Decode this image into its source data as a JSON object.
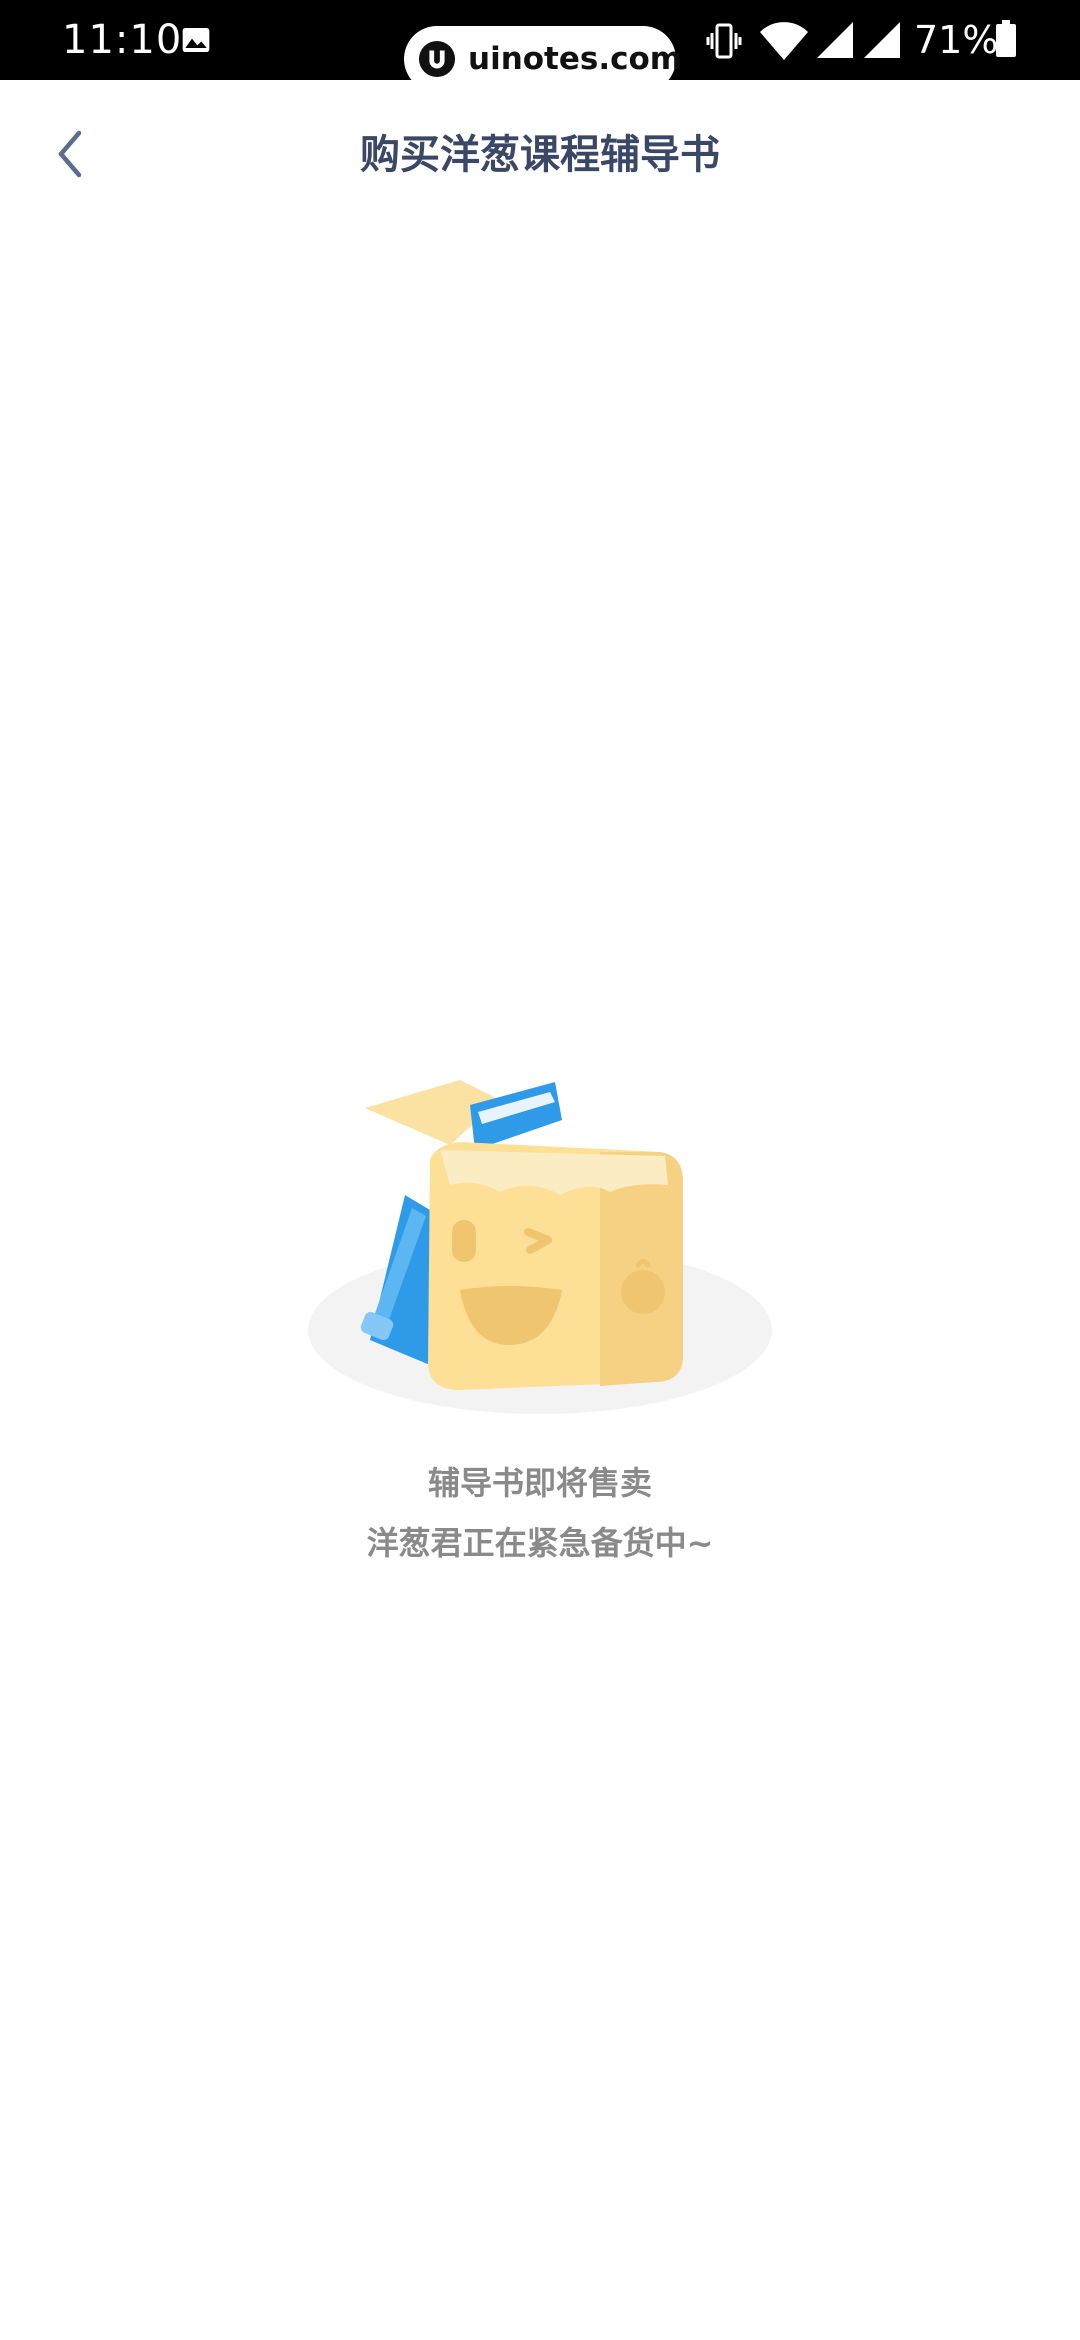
{
  "status_bar": {
    "time": "11:10",
    "battery_percent": "71%",
    "icons": [
      "gallery-icon",
      "vibrate-icon",
      "wifi-icon",
      "signal-icon",
      "signal-icon",
      "battery-icon"
    ]
  },
  "watermark": {
    "text": "uinotes.com"
  },
  "app_bar": {
    "title": "购买洋葱课程辅导书",
    "back_icon": "chevron-left-icon"
  },
  "empty_state": {
    "illustration": "box-with-books-illustration",
    "line1": "辅导书即将售卖",
    "line2": "洋葱君正在紧急备货中~"
  },
  "colors": {
    "title": "#3a4766",
    "back_icon": "#5a6c8f",
    "empty_text": "#8a8a8a",
    "status_bar_bg": "#000000",
    "box_yellow": "#fddf95",
    "book_blue": "#2f9be8"
  }
}
